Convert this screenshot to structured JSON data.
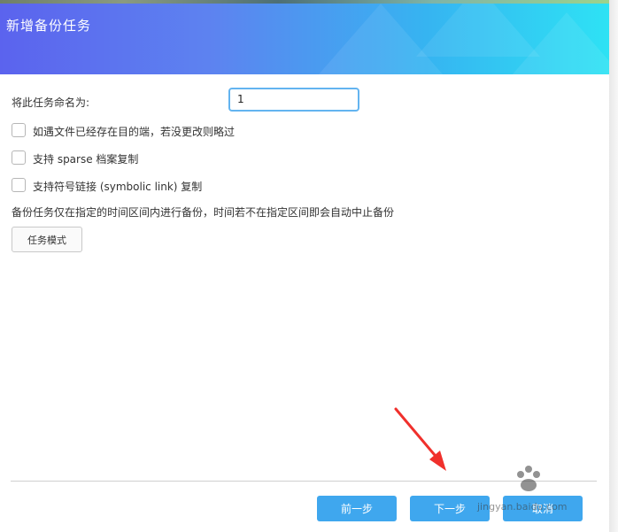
{
  "dialog": {
    "title": "新增备份任务"
  },
  "form": {
    "name_label": "将此任务命名为:",
    "name_value": "1",
    "options": [
      {
        "label": "如遇文件已经存在目的端，若没更改则略过",
        "checked": false
      },
      {
        "label": "支持 sparse 档案复制",
        "checked": false
      },
      {
        "label": "支持符号链接 (symbolic link) 复制",
        "checked": false
      }
    ],
    "schedule_note": "备份任务仅在指定的时间区间内进行备份，时间若不在指定区间即会自动中止备份",
    "task_mode_button": "任务模式"
  },
  "footer": {
    "prev_button": "前一步",
    "next_button": "下一步",
    "cancel_button": "取消"
  },
  "watermark": {
    "text": "jingyan.baidu.com"
  },
  "colors": {
    "header_start": "#5b63ee",
    "header_end": "#2ee2f4",
    "accent": "#3fa7ee",
    "annotation_arrow": "#f0302c"
  }
}
